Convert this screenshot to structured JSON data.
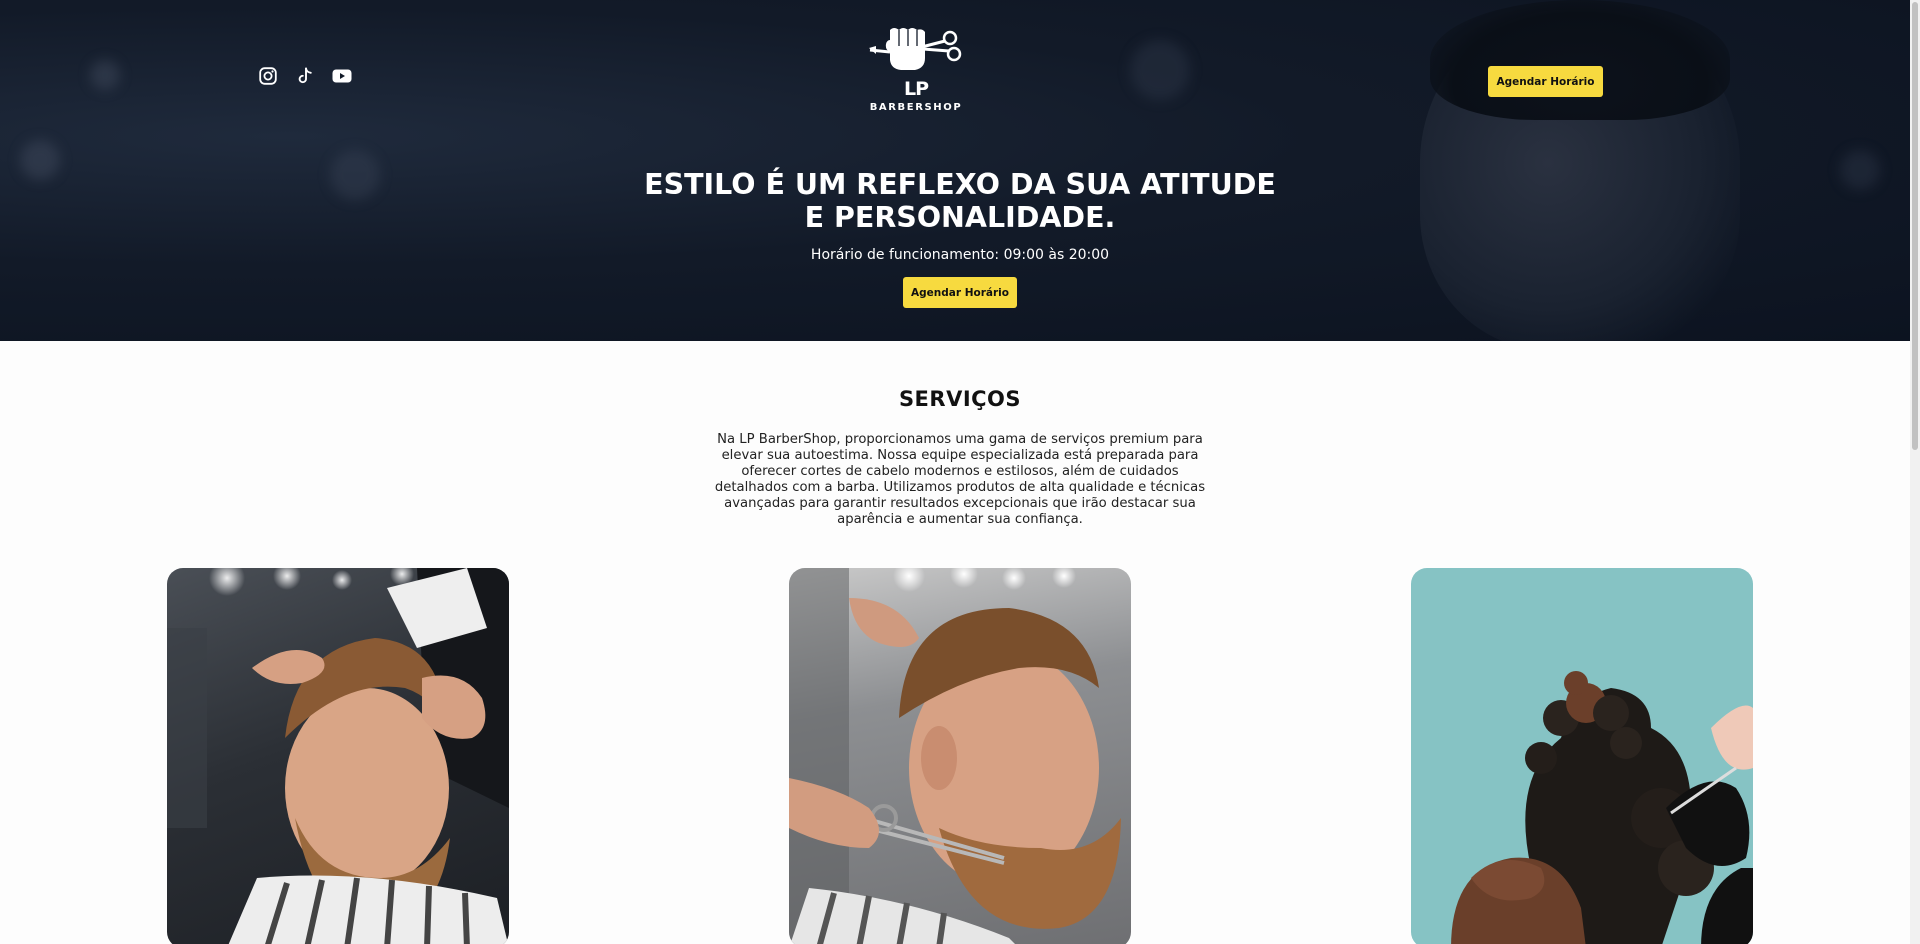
{
  "header": {
    "socials": [
      {
        "name": "instagram-icon"
      },
      {
        "name": "tiktok-icon"
      },
      {
        "name": "youtube-icon"
      }
    ],
    "logo": {
      "title": "LP",
      "subtitle": "BARBERSHOP"
    },
    "cta_label": "Agendar Horário"
  },
  "hero": {
    "title_line1": "ESTILO É UM REFLEXO DA SUA ATITUDE",
    "title_line2": "E PERSONALIDADE.",
    "hours": "Horário de funcionamento: 09:00 às 20:00",
    "cta_label": "Agendar Horário"
  },
  "services": {
    "title": "SERVIÇOS",
    "description": "Na LP BarberShop, proporcionamos uma gama de serviços premium para elevar sua autoestima. Nossa equipe especializada está preparada para oferecer cortes de cabelo modernos e estilosos, além de cuidados detalhados com a barba. Utilizamos produtos de alta qualidade e técnicas avançadas para garantir resultados excepcionais que irão destacar sua aparência e aumentar sua confiança."
  },
  "colors": {
    "accent": "#f7da3f",
    "hero_bg": "#121a28",
    "card3_bg": "#86c3c4"
  }
}
